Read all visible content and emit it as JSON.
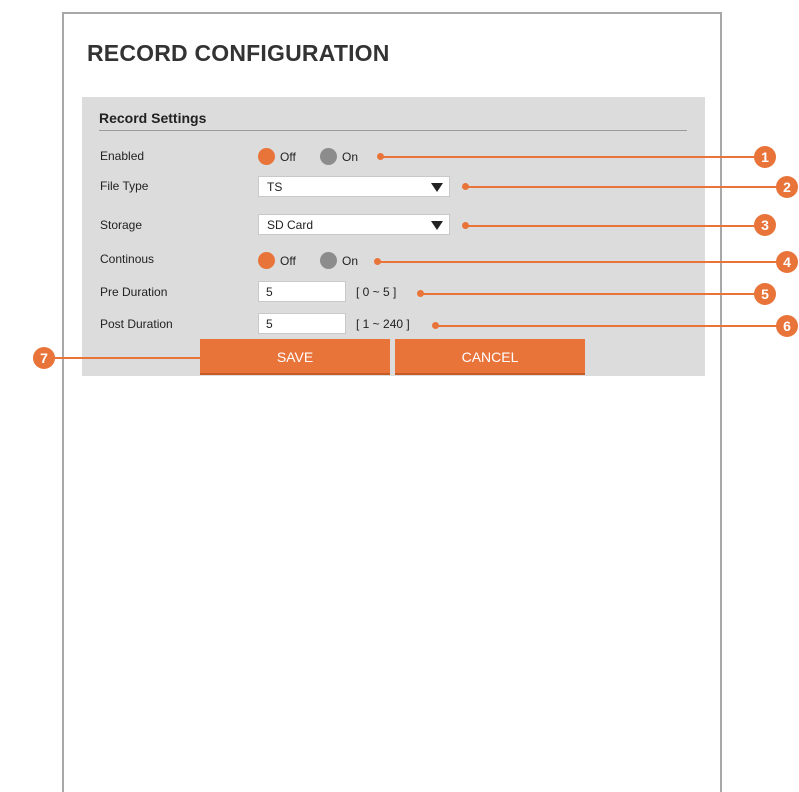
{
  "page": {
    "title": "RECORD CONFIGURATION"
  },
  "section": {
    "title": "Record Settings"
  },
  "enabled": {
    "label": "Enabled",
    "off_label": "Off",
    "on_label": "On",
    "selected": "Off"
  },
  "file_type": {
    "label": "File Type",
    "value": "TS",
    "icon": "dropdown-arrow-icon"
  },
  "storage": {
    "label": "Storage",
    "value": "SD Card",
    "icon": "dropdown-arrow-icon"
  },
  "continous": {
    "label": "Continous",
    "off_label": "Off",
    "on_label": "On",
    "selected": "Off"
  },
  "pre_duration": {
    "label": "Pre Duration",
    "value": "5",
    "range": "[ 0 ~ 5 ]"
  },
  "post_duration": {
    "label": "Post Duration",
    "value": "5",
    "range": "[ 1 ~ 240 ]"
  },
  "buttons": {
    "save": "SAVE",
    "cancel": "CANCEL"
  },
  "callouts": [
    "1",
    "2",
    "3",
    "4",
    "5",
    "6",
    "7"
  ],
  "colors": {
    "accent": "#e8743a",
    "panel": "#dcdcdc",
    "radio_inactive": "#8c8c8c"
  }
}
